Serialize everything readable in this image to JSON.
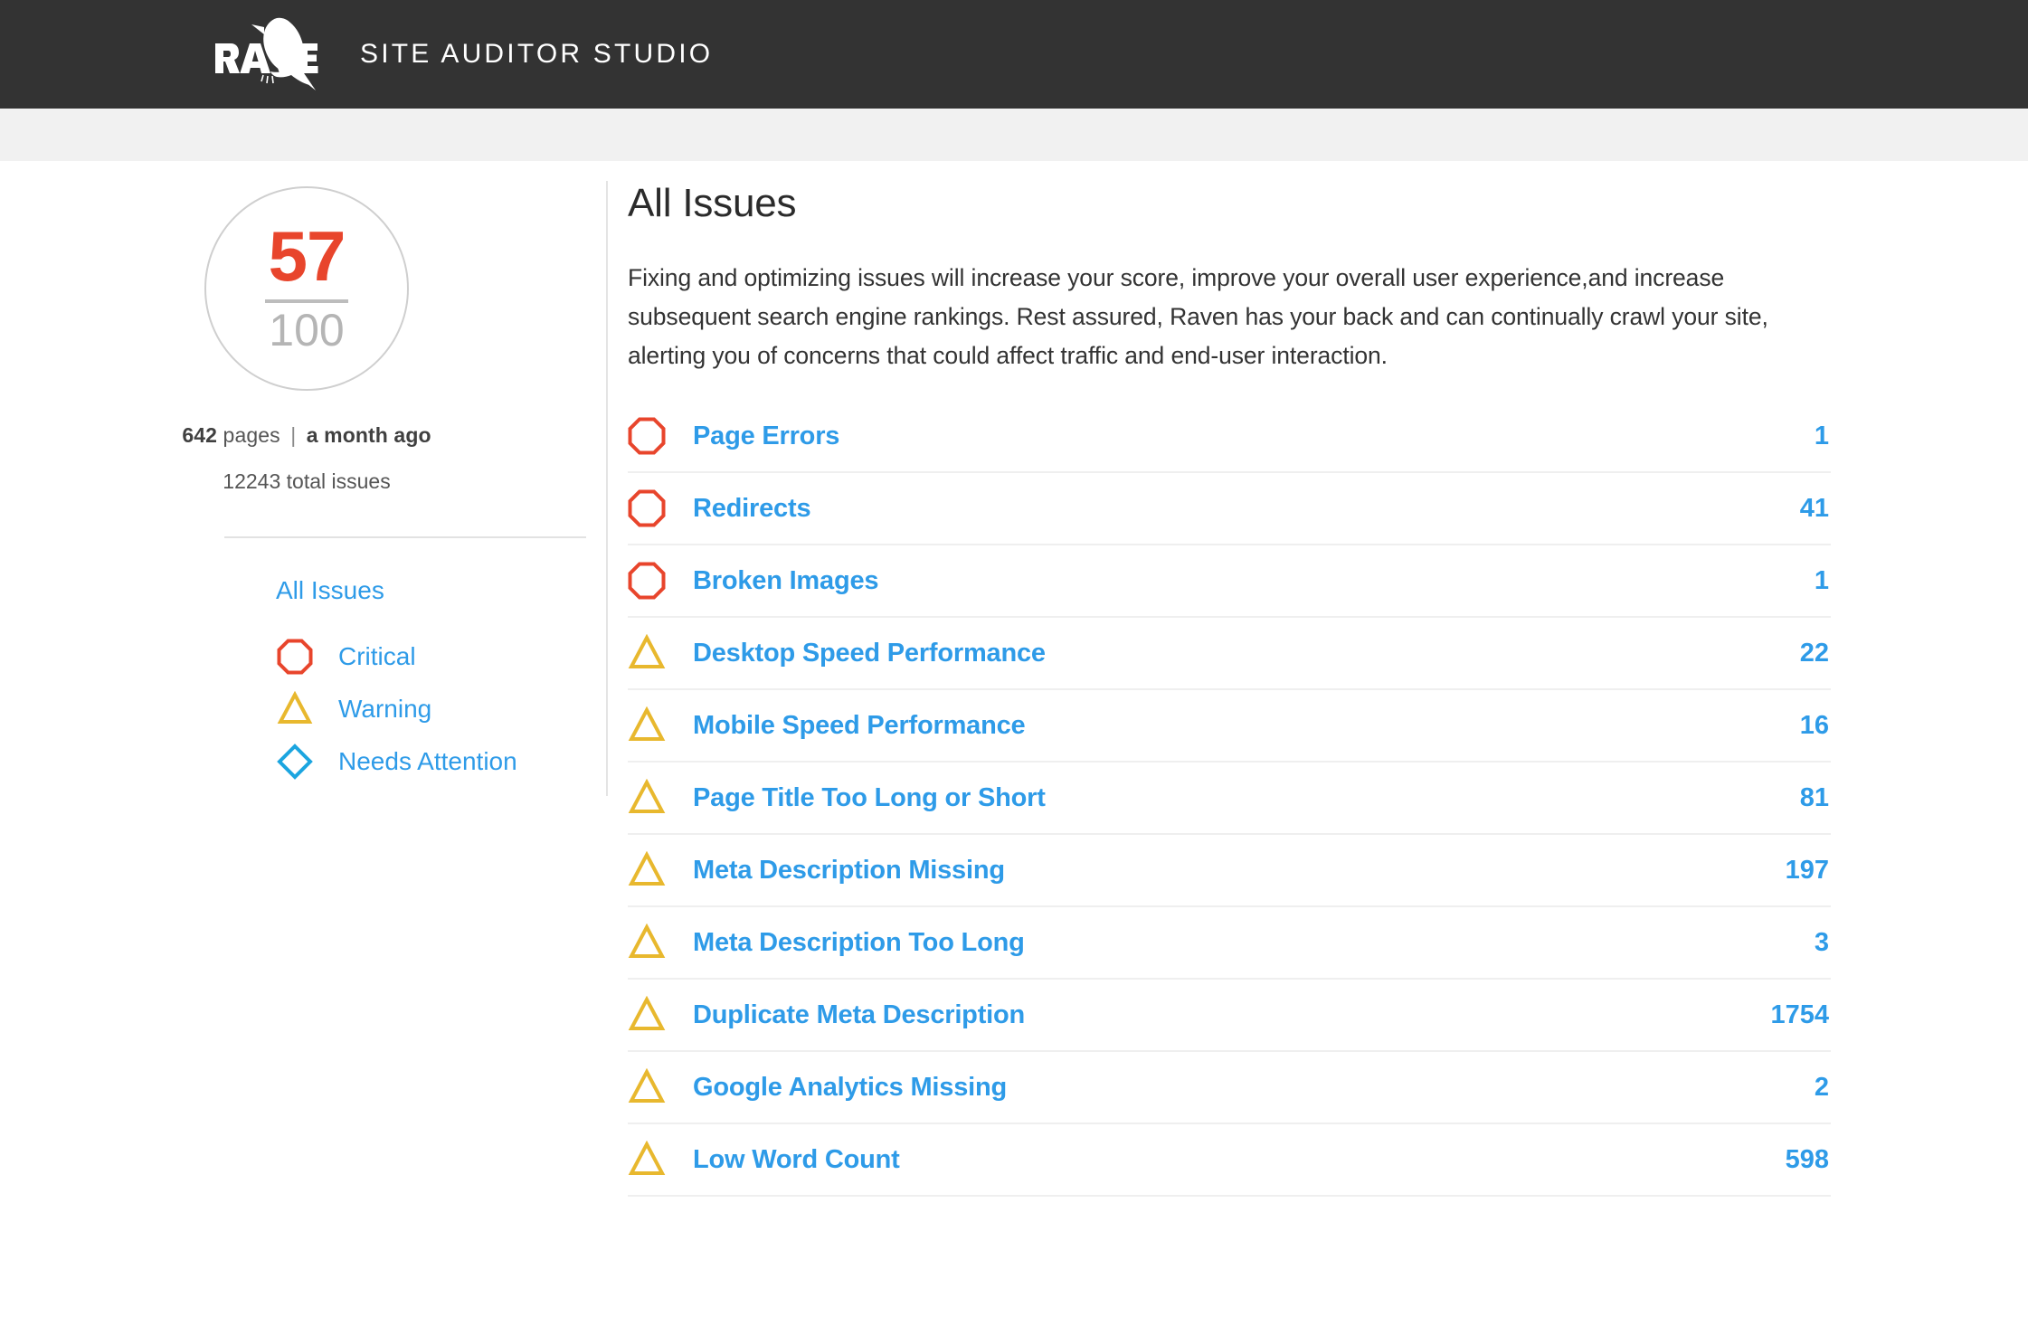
{
  "header": {
    "logo_text": "RAVEN",
    "logo_icon": "raven-bird-logo",
    "app_title": "SITE AUDITOR STUDIO"
  },
  "sidebar": {
    "score": {
      "value": "57",
      "max": "100",
      "accent_color": "#e8452c"
    },
    "meta": {
      "pages_count": "642",
      "pages_label": "pages",
      "separator": "|",
      "last_crawl": "a month ago",
      "total_issues_count": "12243",
      "total_issues_label": "total issues"
    },
    "nav": {
      "all_issues_label": "All Issues",
      "items": [
        {
          "label": "Critical",
          "icon": "octagon-icon",
          "color": "#e8452c"
        },
        {
          "label": "Warning",
          "icon": "triangle-icon",
          "color": "#e8b82e"
        },
        {
          "label": "Needs Attention",
          "icon": "diamond-icon",
          "color": "#1ba5e0"
        }
      ]
    }
  },
  "main": {
    "title": "All Issues",
    "description": "Fixing and optimizing issues will increase your score, improve your overall user experience,and increase subsequent search engine rankings. Rest assured, Raven has your back and can continually crawl your site, alerting you of concerns that could affect traffic and end-user interaction.",
    "issues": [
      {
        "label": "Page Errors",
        "count": "1",
        "severity": "critical",
        "icon": "octagon-icon"
      },
      {
        "label": "Redirects",
        "count": "41",
        "severity": "critical",
        "icon": "octagon-icon"
      },
      {
        "label": "Broken Images",
        "count": "1",
        "severity": "critical",
        "icon": "octagon-icon"
      },
      {
        "label": "Desktop Speed Performance",
        "count": "22",
        "severity": "warning",
        "icon": "triangle-icon"
      },
      {
        "label": "Mobile Speed Performance",
        "count": "16",
        "severity": "warning",
        "icon": "triangle-icon"
      },
      {
        "label": "Page Title Too Long or Short",
        "count": "81",
        "severity": "warning",
        "icon": "triangle-icon"
      },
      {
        "label": "Meta Description Missing",
        "count": "197",
        "severity": "warning",
        "icon": "triangle-icon"
      },
      {
        "label": "Meta Description Too Long",
        "count": "3",
        "severity": "warning",
        "icon": "triangle-icon"
      },
      {
        "label": "Duplicate Meta Description",
        "count": "1754",
        "severity": "warning",
        "icon": "triangle-icon"
      },
      {
        "label": "Google Analytics Missing",
        "count": "2",
        "severity": "warning",
        "icon": "triangle-icon"
      },
      {
        "label": "Low Word Count",
        "count": "598",
        "severity": "warning",
        "icon": "triangle-icon"
      }
    ]
  },
  "colors": {
    "critical": "#e8452c",
    "warning": "#e8b82e",
    "attention": "#1ba5e0",
    "link": "#2e9be8",
    "header_bg": "#333333",
    "subbar_bg": "#f1f1f1"
  }
}
